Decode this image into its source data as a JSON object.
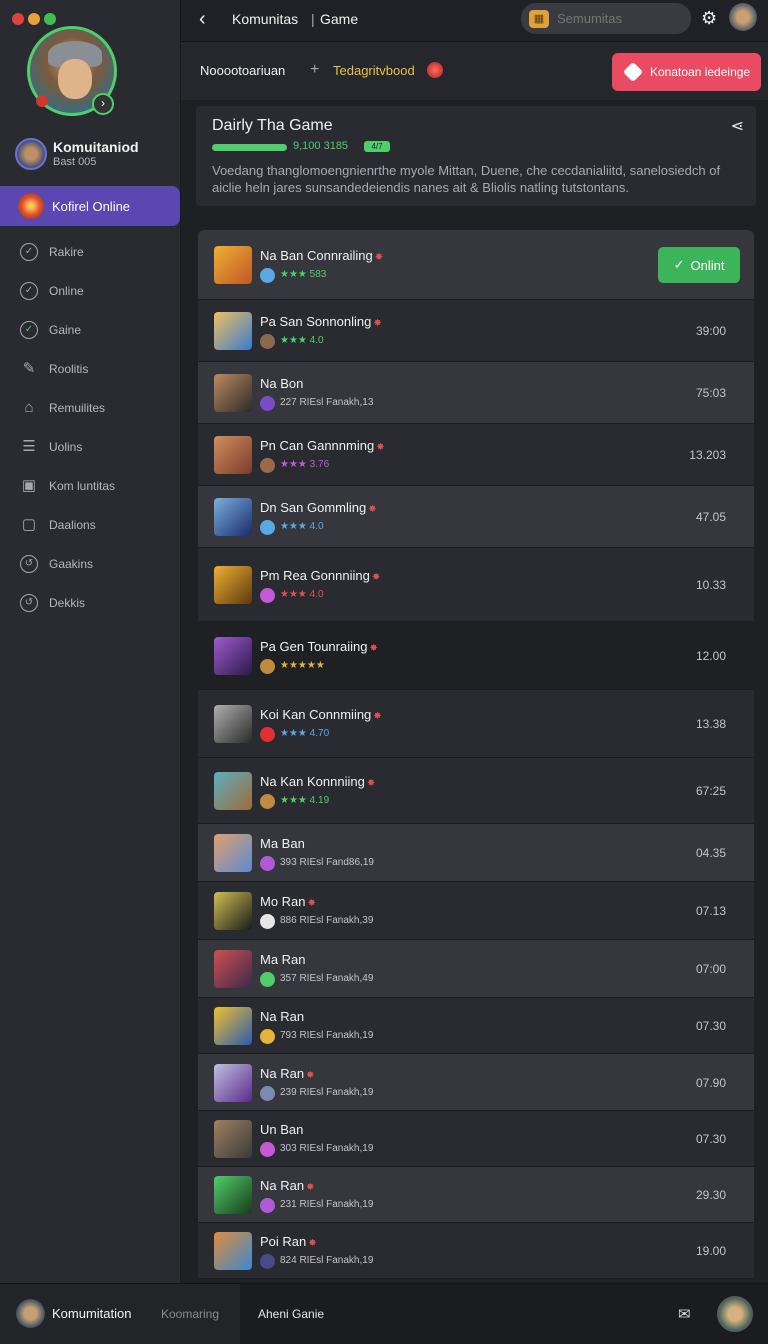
{
  "window": {
    "traffic_colors": [
      "#e0413c",
      "#e6a23a",
      "#3fbf53"
    ]
  },
  "sidebar": {
    "profile_name": "Komuitaniod",
    "profile_sub": "Bast 005",
    "active_label": "Kofirel Online",
    "items": [
      {
        "label": "Rakire",
        "icon": "circle-check-icon"
      },
      {
        "label": "Online",
        "icon": "circle-check-icon"
      },
      {
        "label": "Gaine",
        "icon": "circle-check-icon"
      },
      {
        "label": "Roolitis",
        "icon": "pen-icon"
      },
      {
        "label": "Remuilites",
        "icon": "home-icon"
      },
      {
        "label": "Uolins",
        "icon": "list-icon"
      },
      {
        "label": "Kom luntitas",
        "icon": "briefcase-icon"
      },
      {
        "label": "Daalions",
        "icon": "square-icon"
      },
      {
        "label": "Gaakins",
        "icon": "circle-arrow-icon"
      },
      {
        "label": "Dekkis",
        "icon": "circle-arrow-icon"
      }
    ]
  },
  "topbar": {
    "crumb1": "Komunitas",
    "crumb_sep": "|",
    "crumb2": "Game",
    "search_placeholder": "Semumitas"
  },
  "subheader": {
    "name": "Nooootoariuan",
    "plus": "+",
    "tag": "Tedagritvbood",
    "cta_label": "Konatoan iedeinge"
  },
  "intro": {
    "title": "Dairly Tha Game",
    "progress_text": "9,100 3185",
    "progress_badge": "4/7",
    "description": "Voedang thanglomoengnienrthe myole Mittan, Duene, che cecdanialiitd, sanelosiedch of aiclie heln jares sunsandedeiendis nanes ait & Bliolis natling tutstontans."
  },
  "rows": [
    {
      "title": "Na Ban Connrailing",
      "title_star": true,
      "meta": "★★★ 583",
      "meta_color": "#4ecf6a",
      "time": "",
      "online": "Onlint",
      "thumb": [
        "#f0b030",
        "#c0562a"
      ],
      "meta_icon": "#5aa9e6",
      "bg": "#36373c",
      "h": 70
    },
    {
      "title": "Pa San Sonnonling",
      "title_star": true,
      "meta": "★★★ 4.0",
      "meta_color": "#4ecf6a",
      "time": "39:00",
      "thumb": [
        "#f0c060",
        "#3a7ad0"
      ],
      "meta_icon": "#8a6a4a",
      "bg": "#2a2b30",
      "h": 62
    },
    {
      "title": "Na Bon",
      "title_star": false,
      "meta": "227 RIEsl Fanakh,13",
      "meta_color": "#c4c5ca",
      "time": "75:03",
      "thumb": [
        "#c08a60",
        "#2a2a2a"
      ],
      "meta_icon": "#7a4ac8",
      "bg": "#36373c",
      "h": 62
    },
    {
      "title": "Pn Can Gannnming",
      "title_star": true,
      "meta": "★★★ 3.76",
      "meta_color": "#c45ad8",
      "time": "13.203",
      "thumb": [
        "#d09060",
        "#7a3a2a"
      ],
      "meta_icon": "#9a6a4a",
      "bg": "#2a2b30",
      "h": 62
    },
    {
      "title": "Dn San Gommling",
      "title_star": true,
      "meta": "★★★ 4.0",
      "meta_color": "#5aa9e6",
      "time": "47.05",
      "thumb": [
        "#7ab0e0",
        "#1a2a6a"
      ],
      "meta_icon": "#5aa9e6",
      "bg": "#36373c",
      "h": 62
    },
    {
      "title": "Pm Rea Gonnniing",
      "title_star": true,
      "meta": "★★★ 4.0",
      "meta_color": "#e05050",
      "time": "10.33",
      "thumb": [
        "#f0b030",
        "#5a3a10"
      ],
      "meta_icon": "#c45ad8",
      "bg": "#2a2b30",
      "h": 74
    },
    {
      "title": "Pa Gen Tounraiing",
      "title_star": true,
      "meta": "★★★★★",
      "meta_color": "#e6b23a",
      "time": "12.00",
      "thumb": [
        "#a05ad0",
        "#2a1a4a"
      ],
      "meta_icon": "#c08a40",
      "bg": "#1f2024",
      "h": 68
    },
    {
      "title": "Koi Kan Connmiing",
      "title_star": true,
      "meta": "★★★ 4.70",
      "meta_color": "#5aa9e6",
      "time": "13.38",
      "thumb": [
        "#b0b0b0",
        "#2a2a2a"
      ],
      "meta_icon": "#e03030",
      "bg": "#2a2b30",
      "h": 68
    },
    {
      "title": "Na Kan Konnniing",
      "title_star": true,
      "meta": "★★★ 4.19",
      "meta_color": "#4ecf6a",
      "time": "67:25",
      "thumb": [
        "#5ab0c0",
        "#a06a3a"
      ],
      "meta_icon": "#c08a40",
      "bg": "#2a2b30",
      "h": 66
    },
    {
      "title": "Ma Ban",
      "title_star": false,
      "meta": "393 RIEsl Fand86,19",
      "meta_color": "#c4c5ca",
      "time": "04.35",
      "thumb": [
        "#e0a070",
        "#5a8ad0"
      ],
      "meta_icon": "#b05ad8",
      "bg": "#36373c",
      "h": 58
    },
    {
      "title": "Mo Ran",
      "title_star": true,
      "meta": "886 RIEsl Fanakh,39",
      "meta_color": "#c4c5ca",
      "time": "07.13",
      "thumb": [
        "#d0c050",
        "#1a1a1a"
      ],
      "meta_icon": "#e6e6e6",
      "bg": "#2a2b30",
      "h": 58
    },
    {
      "title": "Ma Ran",
      "title_star": false,
      "meta": "357 RIEsl Fanakh,49",
      "meta_color": "#c4c5ca",
      "time": "07:00",
      "thumb": [
        "#d05050",
        "#3a2a4a"
      ],
      "meta_icon": "#4ecf6a",
      "bg": "#36373c",
      "h": 58
    },
    {
      "title": "Na Ran",
      "title_star": false,
      "meta": "793 RIEsl Fanakh,19",
      "meta_color": "#c4c5ca",
      "time": "07.30",
      "thumb": [
        "#f0c030",
        "#2a5ab0"
      ],
      "meta_icon": "#e6b23a",
      "bg": "#2a2b30",
      "h": 56
    },
    {
      "title": "Na Ran",
      "title_star": true,
      "meta": "239 RIEsl Fanakh,19",
      "meta_color": "#c4c5ca",
      "time": "07.90",
      "thumb": [
        "#c0c0e0",
        "#5a2a8a"
      ],
      "meta_icon": "#7a8ab0",
      "bg": "#36373c",
      "h": 57
    },
    {
      "title": "Un Ban",
      "title_star": false,
      "meta": "303 RIEsl Fanakh,19",
      "meta_color": "#c4c5ca",
      "time": "07.30",
      "thumb": [
        "#a08060",
        "#3a3a3a"
      ],
      "meta_icon": "#c45ad8",
      "bg": "#2a2b30",
      "h": 56
    },
    {
      "title": "Na Ran",
      "title_star": true,
      "meta": "231 RIEsl Fanakh,19",
      "meta_color": "#c4c5ca",
      "time": "29.30",
      "thumb": [
        "#4ecf6a",
        "#1a3a1a"
      ],
      "meta_icon": "#b05ad8",
      "bg": "#36373c",
      "h": 56
    },
    {
      "title": "Poi Ran",
      "title_star": true,
      "meta": "824 RIEsl Fanakh,19",
      "meta_color": "#c4c5ca",
      "time": "19.00",
      "thumb": [
        "#e08a3a",
        "#3a8ad0"
      ],
      "meta_icon": "#4a4a8a",
      "bg": "#2a2b30",
      "h": 56
    }
  ],
  "bottombar": {
    "name": "Komumitation",
    "tab1": "Koomaring",
    "tab2": "Aheni Ganie"
  }
}
